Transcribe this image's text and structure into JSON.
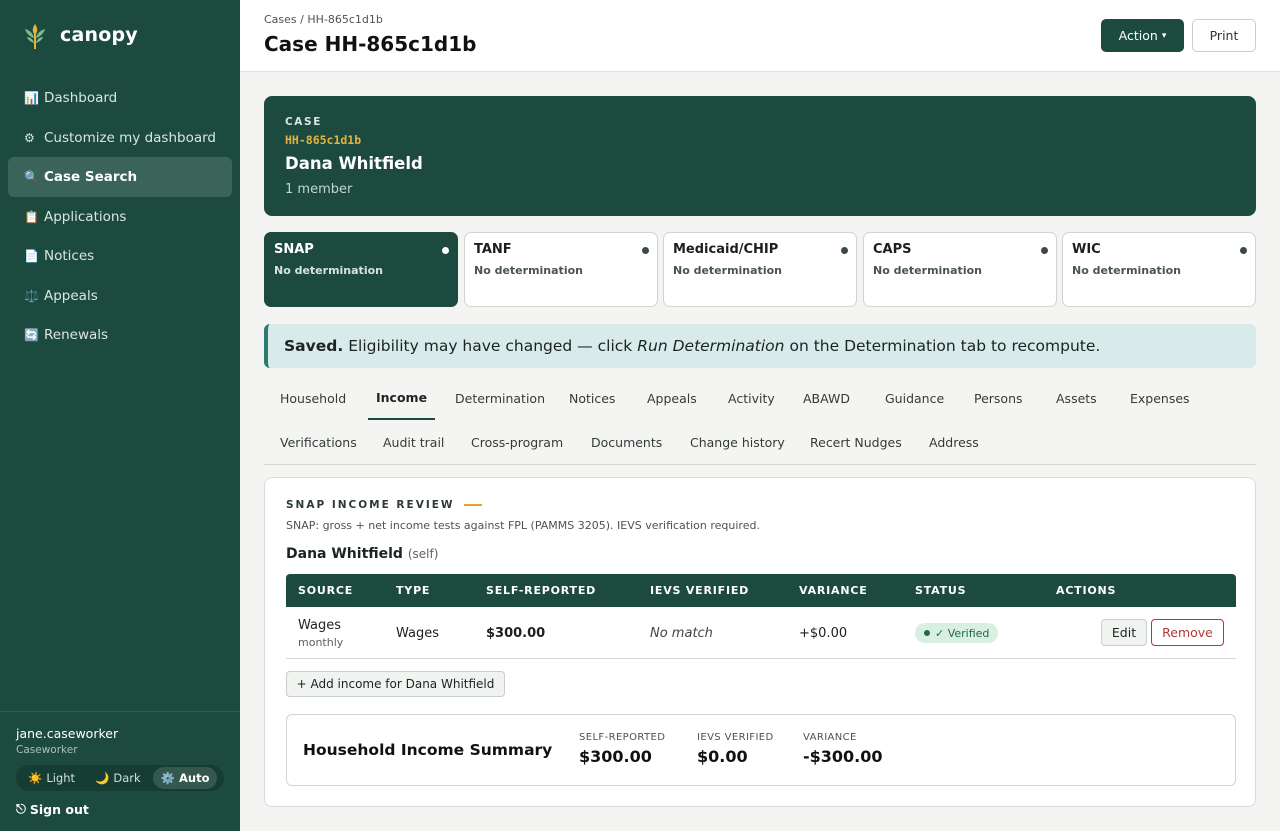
{
  "brand": {
    "name": "canopy"
  },
  "sidebar": {
    "items": [
      {
        "icon": "📊",
        "label": "Dashboard"
      },
      {
        "icon": "⚙",
        "label": "Customize my dashboard"
      },
      {
        "icon": "🔍",
        "label": "Case Search"
      },
      {
        "icon": "📋",
        "label": "Applications"
      },
      {
        "icon": "📄",
        "label": "Notices"
      },
      {
        "icon": "⚖️",
        "label": "Appeals"
      },
      {
        "icon": "🔄",
        "label": "Renewals"
      }
    ],
    "active_index": 2,
    "user": {
      "name": "jane.caseworker",
      "role": "Caseworker"
    },
    "theme": {
      "options": [
        {
          "icon": "☀️",
          "label": "Light"
        },
        {
          "icon": "🌙",
          "label": "Dark"
        },
        {
          "icon": "⚙️",
          "label": "Auto"
        }
      ],
      "selected": "Auto"
    },
    "signout": {
      "icon": "⎋",
      "label": "Sign out"
    }
  },
  "header": {
    "breadcrumb": "Cases / HH-865c1d1b",
    "title": "Case HH-865c1d1b",
    "action_label": "Action",
    "action_caret": "▾",
    "print_label": "Print"
  },
  "case": {
    "kicker": "CASE",
    "id": "HH-865c1d1b",
    "name": "Dana Whitfield",
    "members": "1 member"
  },
  "programs": [
    {
      "name": "SNAP",
      "status": "No determination"
    },
    {
      "name": "TANF",
      "status": "No determination"
    },
    {
      "name": "Medicaid/CHIP",
      "status": "No determination"
    },
    {
      "name": "CAPS",
      "status": "No determination"
    },
    {
      "name": "WIC",
      "status": "No determination"
    }
  ],
  "alert": {
    "strong": "Saved.",
    "text_before": "Eligibility may have changed — click",
    "emphasis": "Run Determination",
    "text_after": "on the Determination tab to recompute."
  },
  "tabs": {
    "row1": [
      "Household",
      "Income",
      "Determination",
      "Notices",
      "Appeals",
      "Activity",
      "ABAWD",
      "Guidance",
      "Persons",
      "Assets",
      "Expenses"
    ],
    "row2": [
      "Verifications",
      "Audit trail",
      "Cross-program",
      "Documents",
      "Change history",
      "Recert Nudges",
      "Address"
    ],
    "active": "Income"
  },
  "income": {
    "kicker": "SNAP INCOME REVIEW",
    "description": "SNAP: gross + net income tests against FPL (PAMMS 3205). IEVS verification required.",
    "person_name": "Dana Whitfield",
    "person_rel": "(self)",
    "columns": [
      "SOURCE",
      "TYPE",
      "SELF-REPORTED",
      "IEVS VERIFIED",
      "VARIANCE",
      "STATUS",
      "ACTIONS"
    ],
    "rows": [
      {
        "source": "Wages",
        "frequency": "monthly",
        "type": "Wages",
        "self_reported": "$300.00",
        "ievs_verified": "No match",
        "variance": "+$0.00",
        "status": "✓ Verified",
        "edit_label": "Edit",
        "remove_label": "Remove"
      }
    ],
    "add_label": "+ Add income for Dana Whitfield",
    "summary": {
      "title": "Household Income Summary",
      "self_reported_label": "SELF-REPORTED",
      "self_reported": "$300.00",
      "ievs_label": "IEVS VERIFIED",
      "ievs": "$0.00",
      "variance_label": "VARIANCE",
      "variance": "-$300.00"
    }
  },
  "colors": {
    "sidebar_bg": "#1d4a3f",
    "accent_gold": "#e3b341",
    "danger": "#b03a36",
    "verified": "#1f6a42",
    "alert_bg": "#d8eaea"
  }
}
